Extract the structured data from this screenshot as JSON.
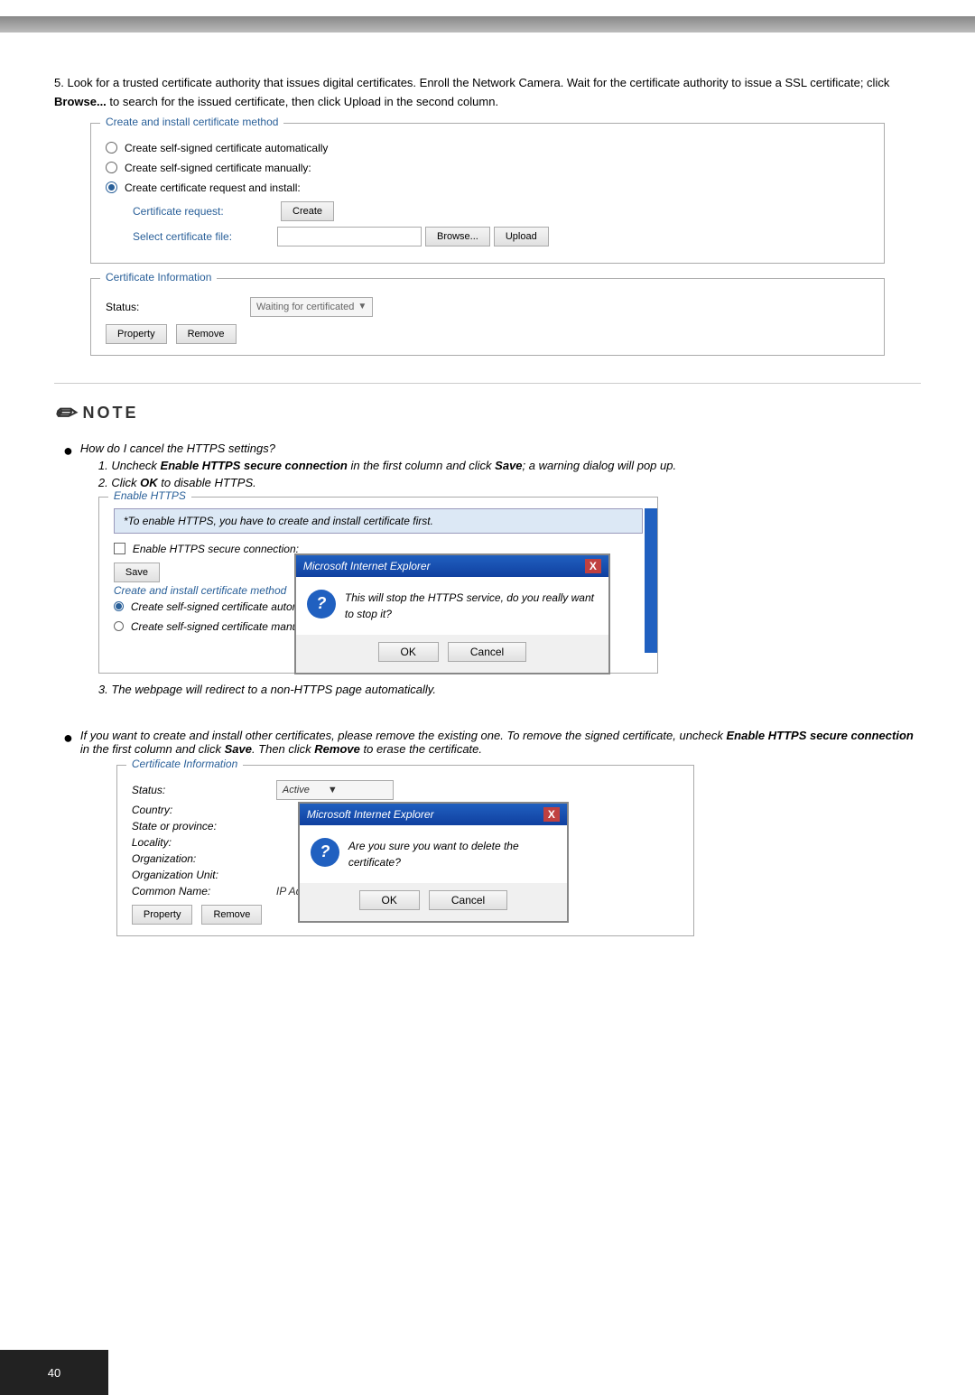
{
  "topBar": {},
  "page": {
    "number": "40"
  },
  "step5": {
    "text": "Look for a trusted certificate authority that issues digital certificates.  Enroll the Network Camera. Wait for the certificate authority to issue a SSL certificate; click ",
    "bold1": "Browse...",
    "text2": " to search for the issued certificate, then click Upload in the second column."
  },
  "panel1": {
    "title": "Create and install certificate method",
    "radio1": "Create self-signed certificate automatically",
    "radio2": "Create self-signed certificate manually:",
    "radio3": "Create certificate request and install:",
    "certRequestLabel": "Certificate request:",
    "createBtnLabel": "Create",
    "selectFileLabel": "Select certificate file:",
    "browseBtnLabel": "Browse...",
    "uploadBtnLabel": "Upload"
  },
  "certInfo1": {
    "title": "Certificate Information",
    "statusLabel": "Status:",
    "statusValue": "Waiting for certificated",
    "dropdownArrow": "v",
    "propertyBtnLabel": "Property",
    "removeBtnLabel": "Remove"
  },
  "note": {
    "iconText": "NOTE",
    "bullet1": "How do I cancel the HTTPS settings?",
    "sub1_1_pre": "Uncheck ",
    "sub1_1_bold": "Enable HTTPS secure connection",
    "sub1_1_post": " in the first column and click ",
    "sub1_1_bold2": "Save",
    "sub1_1_post2": "; a warning dialog will pop up.",
    "sub1_2_pre": "Click ",
    "sub1_2_bold": "OK",
    "sub1_2_post": " to disable HTTPS.",
    "sub1_3": "The webpage will redirect to a non-HTTPS page automatically.",
    "bullet2_pre": "If you want to create and install other certificates, please remove the existing one. To remove the signed certificate, uncheck ",
    "bullet2_bold": "Enable HTTPS secure connection",
    "bullet2_post": " in the first column and click ",
    "bullet2_bold2": "Save",
    "bullet2_post2": ". Then click ",
    "bullet2_bold3": "Remove",
    "bullet2_post3": " to erase the certificate."
  },
  "httpsPanel": {
    "title": "Enable HTTPS",
    "infoBar": "*To enable HTTPS, you have to create and install certificate first.",
    "checkboxLabel": "Enable HTTPS secure connection:",
    "saveBtnLabel": "Save",
    "certMethodTitle": "Create and install certificate method",
    "certAuto": "Create self-signed certificate automatically",
    "certManual": "Create self-signed certificate manually:"
  },
  "dialog1": {
    "title": "Microsoft Internet Explorer",
    "closeBtn": "X",
    "questionText": "This will stop the HTTPS service, do you really want to stop it?",
    "okBtn": "OK",
    "cancelBtn": "Cancel"
  },
  "certInfo2": {
    "title": "Certificate Information",
    "statusLabel": "Status:",
    "statusValue": "Active",
    "dropdownArrow": "v",
    "countryLabel": "Country:",
    "stateLabel": "State or province:",
    "localityLabel": "Locality:",
    "orgLabel": "Organization:",
    "orgUnitLabel": "Organization Unit:",
    "commonNameLabel": "Common Name:",
    "commonNameValue": "IP Address",
    "propertyBtnLabel": "Property",
    "removeBtnLabel": "Remove"
  },
  "dialog2": {
    "title": "Microsoft Internet Explorer",
    "closeBtn": "X",
    "questionText": "Are you sure you want to delete the certificate?",
    "okBtn": "OK",
    "cancelBtn": "Cancel"
  }
}
